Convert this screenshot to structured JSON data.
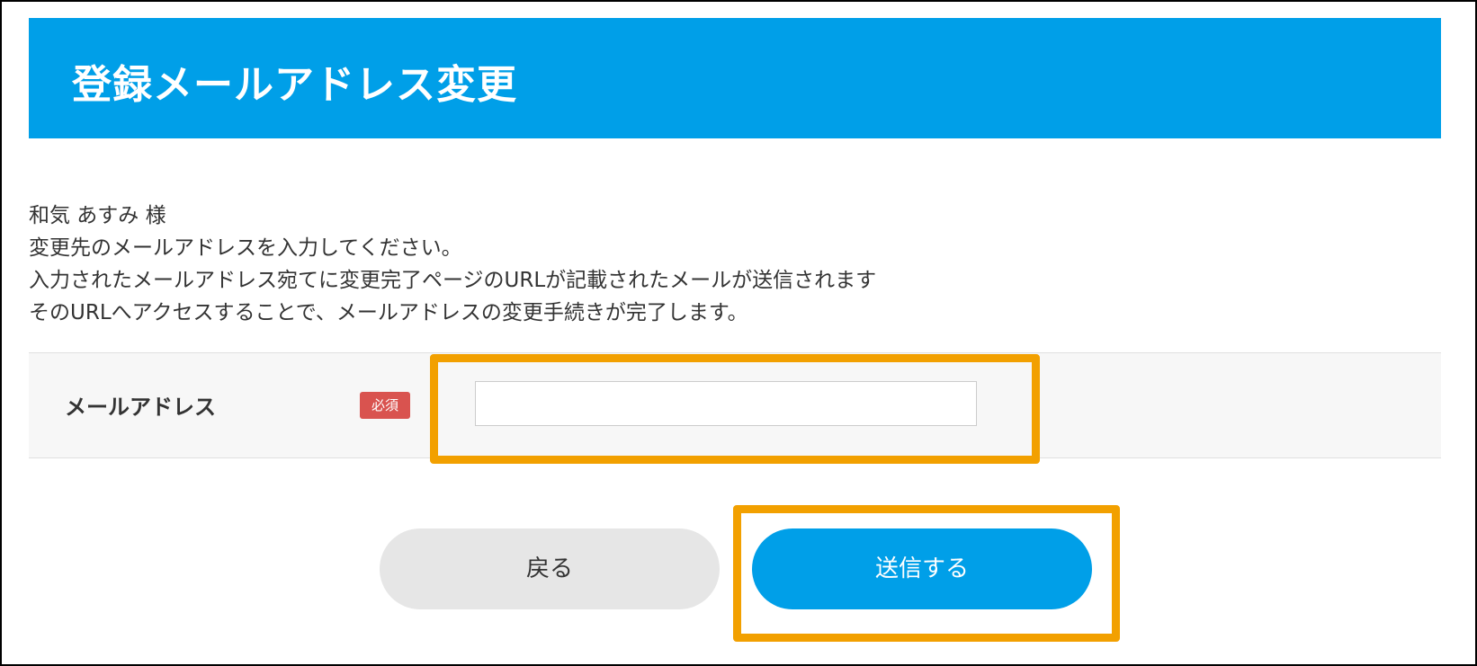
{
  "header": {
    "title": "登録メールアドレス変更"
  },
  "intro": {
    "lines": [
      "和気 あすみ 様",
      "変更先のメールアドレスを入力してください。",
      "入力されたメールアドレス宛てに変更完了ページのURLが記載されたメールが送信されます",
      "そのURLへアクセスすることで、メールアドレスの変更手続きが完了します。"
    ]
  },
  "form": {
    "email_label": "メールアドレス",
    "required_badge": "必須",
    "email_value": "",
    "email_placeholder": ""
  },
  "buttons": {
    "back_label": "戻る",
    "submit_label": "送信する"
  },
  "colors": {
    "header_bg": "#009fe8",
    "submit_bg": "#009fe8",
    "back_bg": "#e6e6e6",
    "required_badge_bg": "#d9534f",
    "highlight": "#f2a000"
  }
}
